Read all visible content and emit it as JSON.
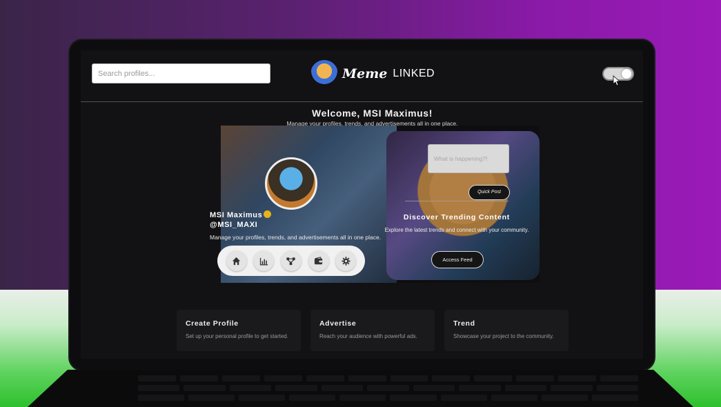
{
  "header": {
    "search": {
      "placeholder": "Search profiles..."
    },
    "logo": {
      "word1": "Meme",
      "word2": "LINKED"
    }
  },
  "welcome": {
    "title": "Welcome, MSI Maximus!",
    "subtitle": "Manage your profiles, trends, and advertisements all in one place."
  },
  "profile": {
    "name": "MSI Maximus",
    "handle": "@MSI_MAXI",
    "description": "Manage your profiles, trends, and advertisements all in one place."
  },
  "dock": {
    "icons": [
      "home-icon",
      "chart-icon",
      "network-icon",
      "wallet-icon",
      "gear-icon"
    ]
  },
  "post": {
    "placeholder": "What is happening?!",
    "button": "Quick Post"
  },
  "trending": {
    "title": "Discover Trending Content",
    "subtitle": "Explore the latest trends and connect with your community.",
    "button": "Access Feed"
  },
  "cards": [
    {
      "title": "Create Profile",
      "desc": "Set up your personal profile to get started."
    },
    {
      "title": "Advertise",
      "desc": "Reach your audience with powerful ads."
    },
    {
      "title": "Trend",
      "desc": "Showcase your project to the community."
    }
  ],
  "colors": {
    "accent": "#e8b21a",
    "screen_bg": "#121214"
  }
}
